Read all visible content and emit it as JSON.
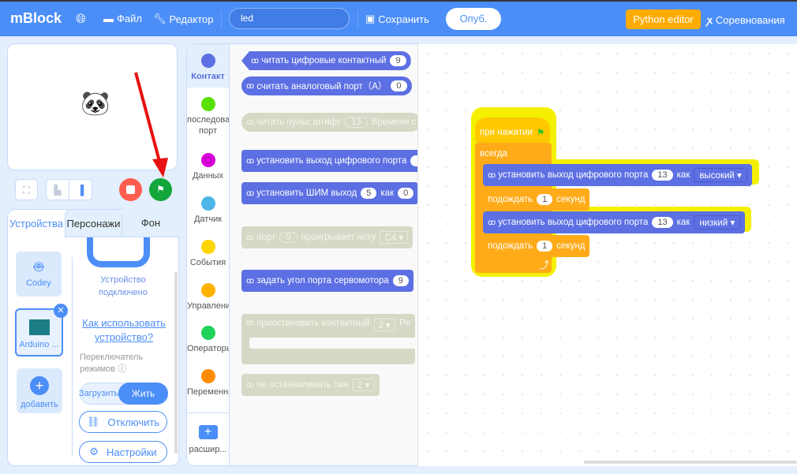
{
  "header": {
    "logo": "mBlock",
    "file": "Файл",
    "editor": "Редактор",
    "search_value": "led",
    "save": "Сохранить",
    "publish": "Опуб.",
    "python_editor": "Python editor",
    "competitions": "Соревнования"
  },
  "left": {
    "tabs": [
      "Устройства",
      "Персонажи",
      "Фон"
    ],
    "devices": [
      {
        "label": "Codey"
      },
      {
        "label": "Arduino ..."
      }
    ],
    "add_label": "добавить",
    "connected": "Устройство подключено",
    "how_to": "Как использовать устройство?",
    "mode_switch": "Переключатель режимов",
    "upload": "Загрузить",
    "live": "Жить",
    "disconnect": "Отключить",
    "settings": "Настройки"
  },
  "categories": [
    {
      "label": "Контакт",
      "color": "#5c6fe3"
    },
    {
      "label": "последова порт",
      "color": "#59e000"
    },
    {
      "label": "Данных",
      "color": "#d500d8"
    },
    {
      "label": "Датчик",
      "color": "#4cb6e8"
    },
    {
      "label": "События",
      "color": "#ffd500"
    },
    {
      "label": "Управлени",
      "color": "#ffb300"
    },
    {
      "label": "Операторы",
      "color": "#1ed25a"
    },
    {
      "label": "Переменны",
      "color": "#ff8c00"
    }
  ],
  "extension_label": "расшир...",
  "palette": {
    "b1": {
      "text": "читать цифровые контактный",
      "v": "9"
    },
    "b2": {
      "text": "считать аналоговый порт（A）",
      "v": "0"
    },
    "b3": {
      "text": "читать пульс штифт",
      "v": "13",
      "t2": "Времени с"
    },
    "b4": {
      "text": "установить выход цифрового порта"
    },
    "b5": {
      "text": "установить ШИМ выход",
      "v": "5",
      "kak": "как",
      "v2": "0"
    },
    "b6": {
      "text": "порт",
      "v": "9",
      "t2": "проигрывает ноту",
      "note": "C4"
    },
    "b7": {
      "text": "задать угол порта сервомотора",
      "v": "9"
    },
    "b8": {
      "text": "приостановить контактный",
      "v": "2",
      "t2": "Ре"
    },
    "b9": {
      "text": "не останавливать пин",
      "v": "2"
    }
  },
  "script": {
    "hat": "при нажатии",
    "forever": "всегда",
    "set1": {
      "text": "установить выход цифрового порта",
      "port": "13",
      "kak": "как",
      "level": "высокий"
    },
    "wait1": {
      "text": "подождать",
      "v": "1",
      "unit": "секунд"
    },
    "set2": {
      "text": "установить выход цифрового порта",
      "port": "13",
      "kak": "как",
      "level": "низкий"
    },
    "wait2": {
      "text": "подождать",
      "v": "1",
      "unit": "секунд"
    }
  }
}
